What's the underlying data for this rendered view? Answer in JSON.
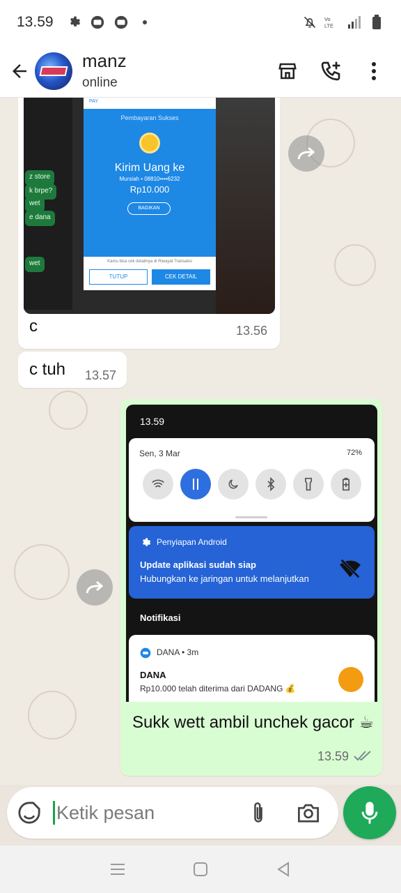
{
  "status_bar": {
    "time": "13.59",
    "icons": [
      "settings-icon",
      "message-icon",
      "message-icon",
      "dot-icon"
    ],
    "right_icons": [
      "mute-icon",
      "volte-icon",
      "signal-icon",
      "battery-icon"
    ]
  },
  "header": {
    "name": "manz",
    "status": "online",
    "actions": [
      "store-icon",
      "add-call-icon",
      "more-vert-icon"
    ]
  },
  "messages": [
    {
      "direction": "incoming",
      "type": "image_with_caption",
      "image": {
        "chats": [
          "z store",
          "k brpe?",
          "wet",
          "e dana",
          "wet"
        ],
        "dana_header": "PAY",
        "payment_title": "Pembayaran Sukses",
        "heading": "Kirim Uang ke",
        "recipient": "Mursiah • 08810••••6232",
        "amount": "Rp10.000",
        "share_button": "BAGIKAN",
        "footer_note": "Kamu bisa cek detailnya di Riwayat Transaksi",
        "close_button": "TUTUP",
        "detail_button": "CEK DETAIL"
      },
      "caption": "c",
      "time": "13.56"
    },
    {
      "direction": "incoming",
      "type": "text",
      "text": "c tuh",
      "time": "13.57"
    },
    {
      "direction": "outgoing",
      "type": "image_with_caption",
      "image": {
        "time": "13.59",
        "date": "Sen, 3 Mar",
        "battery": "72%",
        "notif_app": "Penyiapan Android",
        "notif_title": "Update aplikasi sudah siap",
        "notif_body": "Hubungkan ke jaringan untuk melanjutkan",
        "section": "Notifikasi",
        "dana_app": "DANA • 3m",
        "dana_title": "DANA",
        "dana_body": "Rp10.000 telah diterima dari DADANG 💰"
      },
      "caption": "Sukk wett ambil unchek gacor ☕",
      "time": "13.59",
      "read": true
    }
  ],
  "composer": {
    "placeholder": "Ketik pesan"
  },
  "colors": {
    "accent": "#1faa59",
    "outgoing_bubble": "#d9fdd3",
    "chat_bg": "#efeae2"
  }
}
